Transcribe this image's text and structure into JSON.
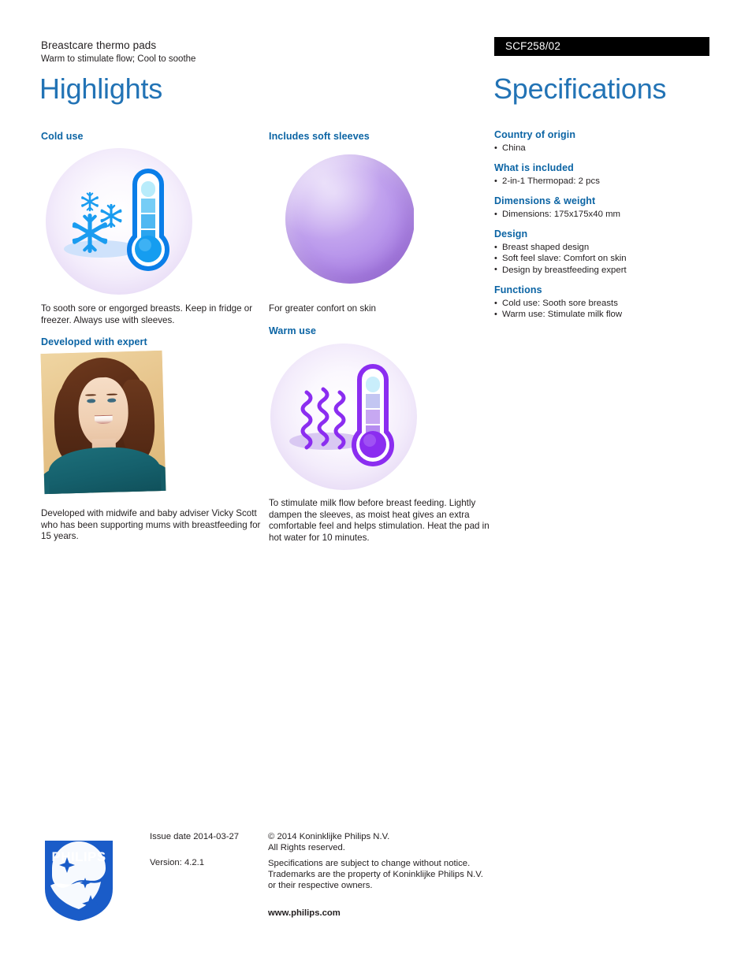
{
  "header": {
    "product_name": "Breastcare thermo pads",
    "tagline": "Warm to stimulate flow; Cool to soothe",
    "sku": "SCF258/02",
    "highlights_title": "Highlights",
    "specifications_title": "Specifications"
  },
  "highlights": {
    "cold_use": {
      "heading": "Cold use",
      "body": "To sooth sore or engorged breasts. Keep in fridge or freezer. Always use with sleeves.",
      "image_name": "cold-use-thermometer-snowflake-illustration"
    },
    "developed_with_expert": {
      "heading": "Developed with expert",
      "body": "Developed with midwife and baby adviser Vicky Scott who has been supporting mums with breastfeeding for 15 years.",
      "image_name": "expert-portrait-photo"
    },
    "soft_sleeves": {
      "heading": "Includes soft sleeves",
      "body": "For greater confort on skin",
      "image_name": "purple-sleeve-sphere-photo"
    },
    "warm_use": {
      "heading": "Warm use",
      "body": "To stimulate milk flow before breast feeding. Lightly dampen the sleeves, as moist heat gives an extra comfortable feel and helps stimulation. Heat the pad in hot water for 10 minutes.",
      "image_name": "warm-use-thermometer-heatwave-illustration"
    }
  },
  "specifications": [
    {
      "heading": "Country of origin",
      "items": [
        "China"
      ]
    },
    {
      "heading": "What is included",
      "items": [
        "2-in-1 Thermopad: 2 pcs"
      ]
    },
    {
      "heading": "Dimensions & weight",
      "items": [
        "Dimensions: 175x175x40 mm"
      ]
    },
    {
      "heading": "Design",
      "items": [
        "Breast shaped design",
        "Soft feel slave: Comfort on skin",
        "Design by breastfeeding expert"
      ]
    },
    {
      "heading": "Functions",
      "items": [
        "Cold use: Sooth sore breasts",
        "Warm use: Stimulate milk flow"
      ]
    }
  ],
  "footer": {
    "logo_text": "PHILIPS",
    "issue_date": "Issue date 2014-03-27",
    "version": "Version: 4.2.1",
    "copyright_line1": "© 2014 Koninklijke Philips N.V.",
    "copyright_line2": "All Rights reserved.",
    "legal_line1": "Specifications are subject to change without notice.",
    "legal_line2": "Trademarks are the property of Koninklijke Philips N.V.",
    "legal_line3": "or their respective owners.",
    "website": "www.philips.com"
  },
  "colors": {
    "heading_blue": "#0b64a4",
    "title_blue": "#2273b5",
    "banner_black": "#000000",
    "philips_blue": "#1a5cc8",
    "cold_icon": "#1a9cf0",
    "warm_icon": "#8b2df0",
    "text": "#231f20"
  }
}
